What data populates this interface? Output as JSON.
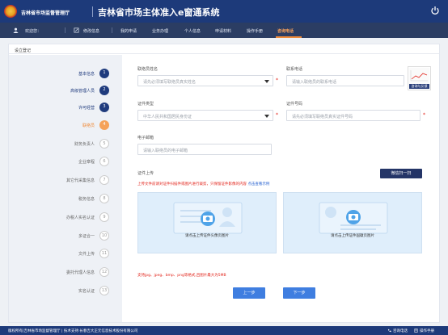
{
  "header": {
    "org_name": "吉林省市场监督管理厅",
    "system_title": "吉林省市场主体准入e窗通系统"
  },
  "nav": {
    "welcome": "欢迎您：",
    "username": "",
    "change_password": "修改信息",
    "items": [
      "我的申请",
      "业务办理",
      "个人信息",
      "申请材料",
      "操作手册",
      "咨询电话"
    ],
    "active_index": 5
  },
  "panel_title": "设立登记",
  "steps": [
    {
      "label": "基本信息",
      "num": "1",
      "state": "done"
    },
    {
      "label": "高级管理人员",
      "num": "2",
      "state": "done"
    },
    {
      "label": "许可经营",
      "num": "3",
      "state": "done"
    },
    {
      "label": "联络员",
      "num": "4",
      "state": "current"
    },
    {
      "label": "财务负责人",
      "num": "5",
      "state": "todo"
    },
    {
      "label": "企业章程",
      "num": "6",
      "state": "todo"
    },
    {
      "label": "其它代采集信息",
      "num": "7",
      "state": "todo"
    },
    {
      "label": "税务信息",
      "num": "8",
      "state": "todo"
    },
    {
      "label": "办税人实名认证",
      "num": "9",
      "state": "todo"
    },
    {
      "label": "多证合一",
      "num": "10",
      "state": "todo"
    },
    {
      "label": "文件上传",
      "num": "11",
      "state": "todo"
    },
    {
      "label": "委托代理人信息",
      "num": "12",
      "state": "todo"
    },
    {
      "label": "实名认证",
      "num": "13",
      "state": "todo"
    }
  ],
  "form": {
    "name_label": "联络员姓名",
    "name_placeholder": "请先必须填写联络员真实姓名",
    "phone_label": "联系电话",
    "phone_placeholder": "请输入联络员的联系电话",
    "idtype_label": "证件类型",
    "idtype_value": "中华人民共和国居民身份证",
    "idno_label": "证件号码",
    "idno_placeholder": "请先必须填写联络员真实证件号码",
    "email_label": "电子邮箱",
    "email_placeholder": "请输入联络员的电子邮箱"
  },
  "qr": {
    "caption": "咨询与反馈"
  },
  "upload": {
    "label": "证件上传",
    "scan_button": "微信扫一扫",
    "note": "上传文件前请对证件扫描件或图片进行裁剪，只保留证件影像的内容",
    "note_link": "点击查看示例",
    "front_caption": "请点击上传证件头像页图片",
    "back_caption": "请点击上传证件国徽页图片",
    "formats": "支持jpg、jpeg、bmp、png等格式,且图片最大为5MB"
  },
  "actions": {
    "prev": "上一步",
    "next": "下一步"
  },
  "footer": {
    "copyright": "版权所有|吉林省市场监督管理厅 | 技术支持:长春吉大正元信息技术股份有限公司",
    "consult": "咨询电话",
    "manual": "操作手册"
  },
  "colors": {
    "header_bg": "#1d3a7a",
    "nav_bg": "#2b3d63",
    "active": "#f08b3a",
    "primary_button": "#3f7ee0",
    "required": "#e2231a"
  }
}
